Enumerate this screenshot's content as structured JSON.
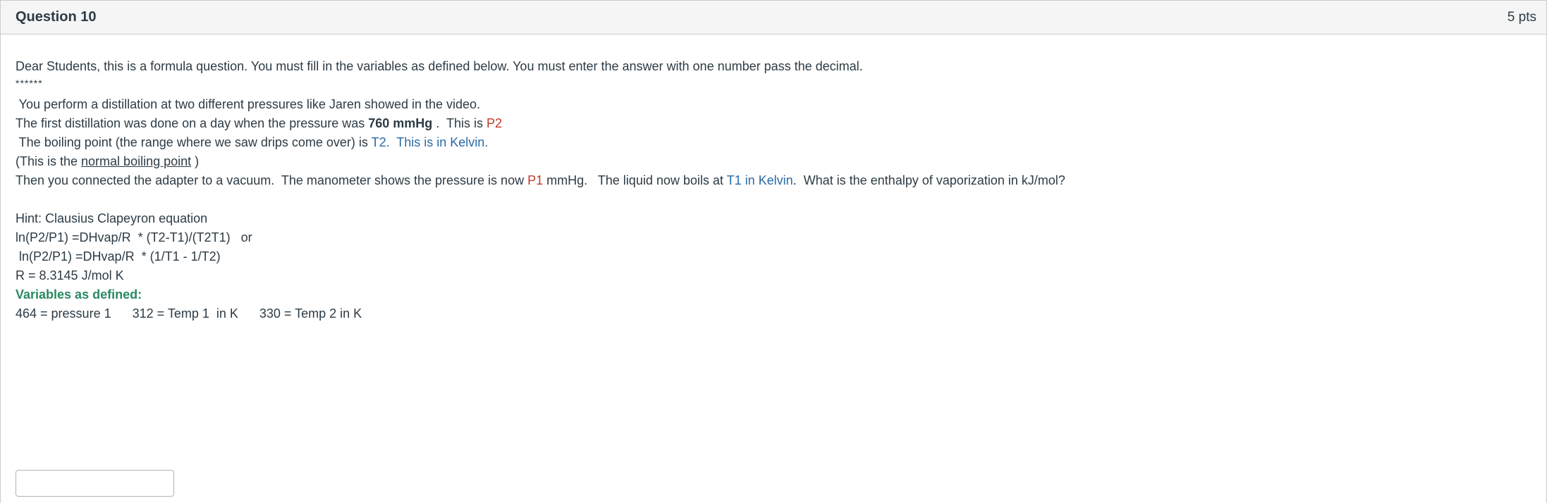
{
  "header": {
    "title": "Question 10",
    "points": "5 pts"
  },
  "body": {
    "intro": "Dear Students, this is a formula question.  You must fill in the variables as defined below.  You must enter the answer with one number pass the decimal.",
    "stars": "******",
    "l1": " You perform a distillation at two different pressures like Jaren showed in the video.",
    "l2": {
      "a": "The first distillation was done on a day when the pressure was ",
      "b": "760 mmHg",
      "c": " .  This is ",
      "d": "P2"
    },
    "l3": {
      "a": " The boiling point (the range where we saw drips come over) is ",
      "b": "T2.  This is in Kelvin."
    },
    "l4": {
      "a": "(This is the ",
      "b": "normal boiling point",
      "c": " )"
    },
    "l5": {
      "a": "Then you connected the adapter to a vacuum.  The manometer shows the pressure is now ",
      "b": "P1",
      "c": " mmHg.   The liquid now boils at ",
      "d": "T1 in Kelvin",
      "e": ".  What is the enthalpy of vaporization in kJ/mol?"
    },
    "hint": "Hint: Clausius Clapeyron equation",
    "eq1": "ln(P2/P1) =DHvap/R  * (T2-T1)/(T2T1)   or",
    "eq2": " ln(P2/P1) =DHvap/R  * (1/T1 - 1/T2)",
    "rconst": "R = 8.3145 J/mol K",
    "vars_label": "Variables as defined:",
    "vars": "464 = pressure 1      312 = Temp 1  in K      330 = Temp 2 in K"
  },
  "answer": {
    "value": ""
  },
  "colors": {
    "red": "#c0392b",
    "blue": "#2a6aa6",
    "green": "#2a8a62"
  }
}
